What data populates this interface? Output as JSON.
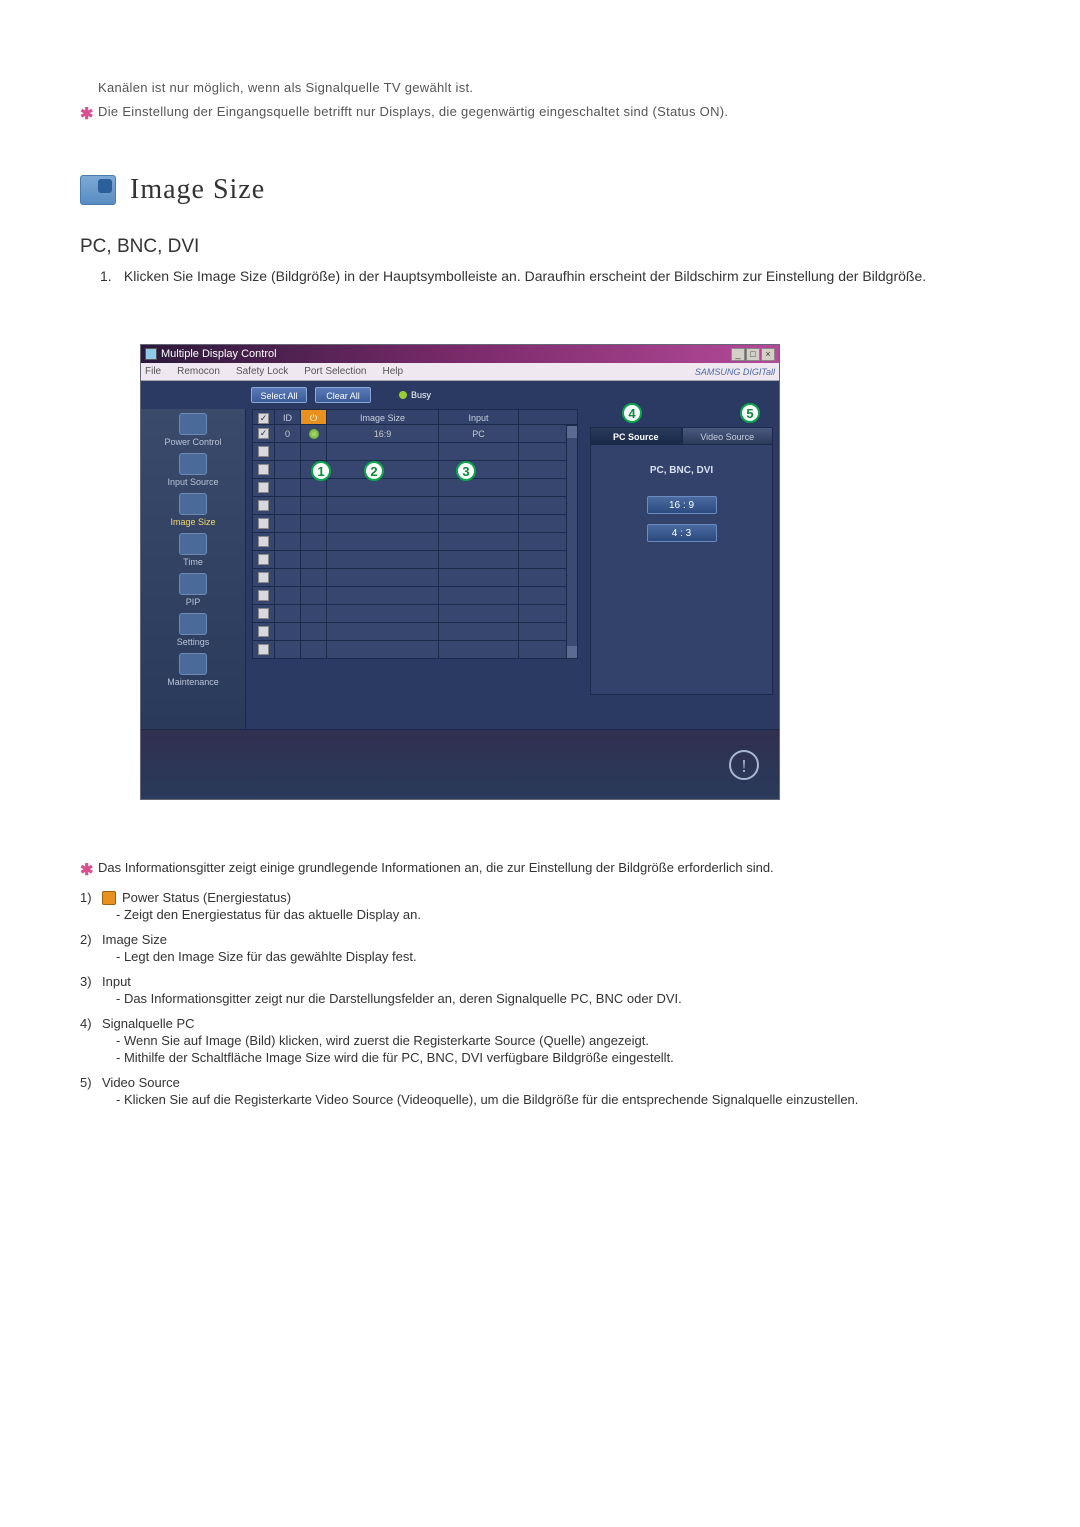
{
  "intro_notes": [
    {
      "star": false,
      "text": "Kanälen ist nur möglich, wenn als Signalquelle TV gewählt ist."
    },
    {
      "star": true,
      "text": "Die Einstellung der Eingangsquelle betrifft nur Displays, die gegenwärtig eingeschaltet sind (Status ON)."
    }
  ],
  "section": {
    "title": "Image Size",
    "subheading": "PC, BNC, DVI",
    "ol1_num": "1.",
    "ol1_text": "Klicken Sie Image Size (Bildgröße) in der Hauptsymbolleiste an. Daraufhin erscheint der Bildschirm zur Einstellung der Bildgröße."
  },
  "app": {
    "title": "Multiple Display Control",
    "win_min": "_",
    "win_max": "□",
    "win_close": "×",
    "menu": [
      "File",
      "Remocon",
      "Safety Lock",
      "Port Selection",
      "Help"
    ],
    "brand": "SAMSUNG DIGITall",
    "toolbar": {
      "select_all": "Select All",
      "clear_all": "Clear All",
      "busy": "Busy"
    },
    "sidebar": [
      {
        "label": "Power Control"
      },
      {
        "label": "Input Source"
      },
      {
        "label": "Image Size",
        "active": true
      },
      {
        "label": "Time"
      },
      {
        "label": "PIP"
      },
      {
        "label": "Settings"
      },
      {
        "label": "Maintenance"
      }
    ],
    "table": {
      "headers": {
        "chk": "",
        "id": "ID",
        "pw": "",
        "size": "Image Size",
        "input": "Input"
      },
      "row0": {
        "chk_checked": true,
        "id": "0",
        "pw": "on",
        "size": "16:9",
        "input": "PC"
      }
    },
    "markers": [
      "1",
      "2",
      "3",
      "4",
      "5"
    ],
    "right": {
      "tab_pc": "PC Source",
      "tab_video": "Video Source",
      "panel_label": "PC, BNC, DVI",
      "ratio1": "16 : 9",
      "ratio2": "4 : 3"
    },
    "info_glyph": "!"
  },
  "after_notes": {
    "star_note": "Das Informationsgitter zeigt einige grundlegende Informationen an, die zur Einstellung der Bildgröße erforderlich sind.",
    "items": [
      {
        "num": "1)",
        "title": "Power Status (Energiestatus)",
        "icon": true,
        "subs": [
          "- Zeigt den Energiestatus für das aktuelle Display an."
        ]
      },
      {
        "num": "2)",
        "title": "Image Size",
        "subs": [
          "- Legt den Image Size für das gewählte Display fest."
        ]
      },
      {
        "num": "3)",
        "title": "Input",
        "subs": [
          "- Das Informationsgitter zeigt nur die Darstellungsfelder an, deren Signalquelle PC, BNC oder DVI."
        ]
      },
      {
        "num": "4)",
        "title": "Signalquelle PC",
        "subs": [
          "- Wenn Sie auf Image (Bild) klicken, wird zuerst die Registerkarte Source (Quelle) angezeigt.",
          "- Mithilfe der Schaltfläche Image Size wird die für PC, BNC, DVI verfügbare Bildgröße eingestellt."
        ]
      },
      {
        "num": "5)",
        "title": "Video Source",
        "subs": [
          "- Klicken Sie auf die Registerkarte Video Source (Videoquelle), um die Bildgröße für die entsprechende Signalquelle einzustellen."
        ]
      }
    ]
  }
}
